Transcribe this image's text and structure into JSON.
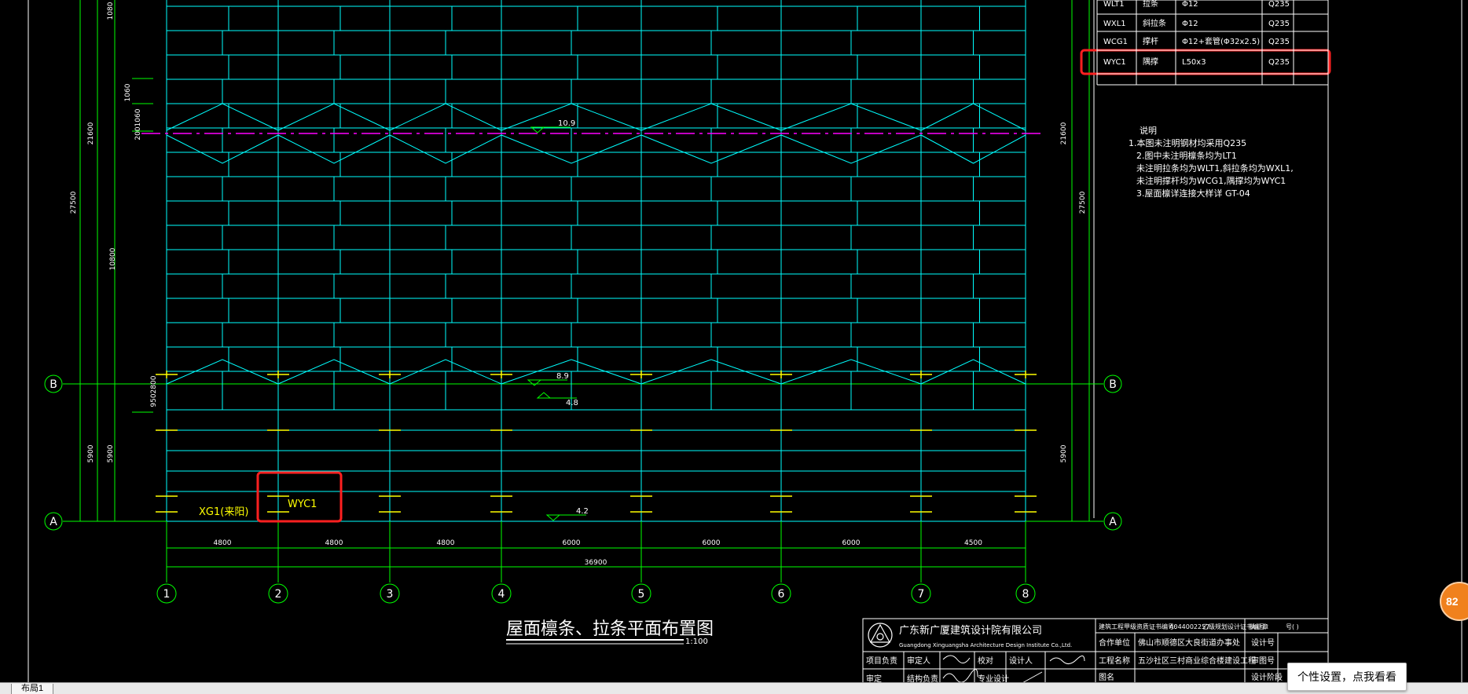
{
  "drawing": {
    "dims_left": [
      "1080",
      "1060",
      "1060",
      "21600",
      "27500",
      "10800",
      "200",
      "950",
      "2800",
      "5900",
      "5900"
    ],
    "dims_right": [
      "21600",
      "27500",
      "5900"
    ],
    "bay_dims": [
      "4800",
      "4800",
      "4800",
      "6000",
      "6000",
      "6000",
      "4500"
    ],
    "total_dim": "36900",
    "axis_cols": [
      "1",
      "2",
      "3",
      "4",
      "5",
      "6",
      "7",
      "8"
    ],
    "axis_rows": [
      "B",
      "A"
    ],
    "elevations": [
      "10.9",
      "8.9",
      "4.8",
      "4.2"
    ],
    "labels": {
      "xg": "XG1(来阳)",
      "wyc": "WYC1"
    },
    "title": "屋面檩条、拉条平面布置图",
    "scale": "1:100"
  },
  "member_table": {
    "rows": [
      [
        "WLT1",
        "拉条",
        "Φ12",
        "Q235"
      ],
      [
        "WXL1",
        "斜拉条",
        "Φ12",
        "Q235"
      ],
      [
        "WCG1",
        "撑杆",
        "Φ12+套管(Φ32x2.5)",
        "Q235"
      ],
      [
        "WYC1",
        "隅撑",
        "L50x3",
        "Q235"
      ]
    ]
  },
  "notes": {
    "heading": "说明",
    "lines": [
      "1.本图未注明钢材均采用Q235",
      "2.图中未注明檩条均为LT1",
      "   未注明拉条均为WLT1,斜拉条均为WXL1,",
      "   未注明撑杆均为WCG1,隅撑均为WYC1",
      "3.屋面檩详连接大样详 GT-04"
    ]
  },
  "title_block": {
    "company_cn": "广东新广厦建筑设计院有限公司",
    "company_en": "Guangdong Xinguangsha Architecture Design Institute Co.,Ltd.",
    "top_row": [
      "建筑工程甲级资质证书编号:",
      "A044002257",
      "乙级规划设计证书编号",
      "执业章",
      "号( )"
    ],
    "fields": [
      [
        "合作单位",
        "佛山市顺德区大良街道办事处"
      ],
      [
        "工程名称",
        "五沙社区三村商业综合楼建设工程"
      ],
      [
        "图名",
        ""
      ]
    ],
    "right_fields": [
      "设计号",
      "审图号",
      "设计阶段"
    ],
    "sign_rows": [
      [
        "项目负责",
        "审定人",
        "校对",
        "设计人"
      ],
      [
        "审定",
        "结构负责",
        "专业设计",
        ""
      ]
    ]
  },
  "ui": {
    "layout_tab": "布局1",
    "tooltip": "个性设置，点我看看",
    "badge": "82"
  },
  "colors": {
    "bg": "#000000",
    "grid": "#00ffff",
    "axis": "#00ff00",
    "purlin_mark": "#ffff00",
    "label_yellow": "#ffff00",
    "white": "#ffffff",
    "highlight": "#ff2020",
    "ridge": "#ff00ff"
  }
}
